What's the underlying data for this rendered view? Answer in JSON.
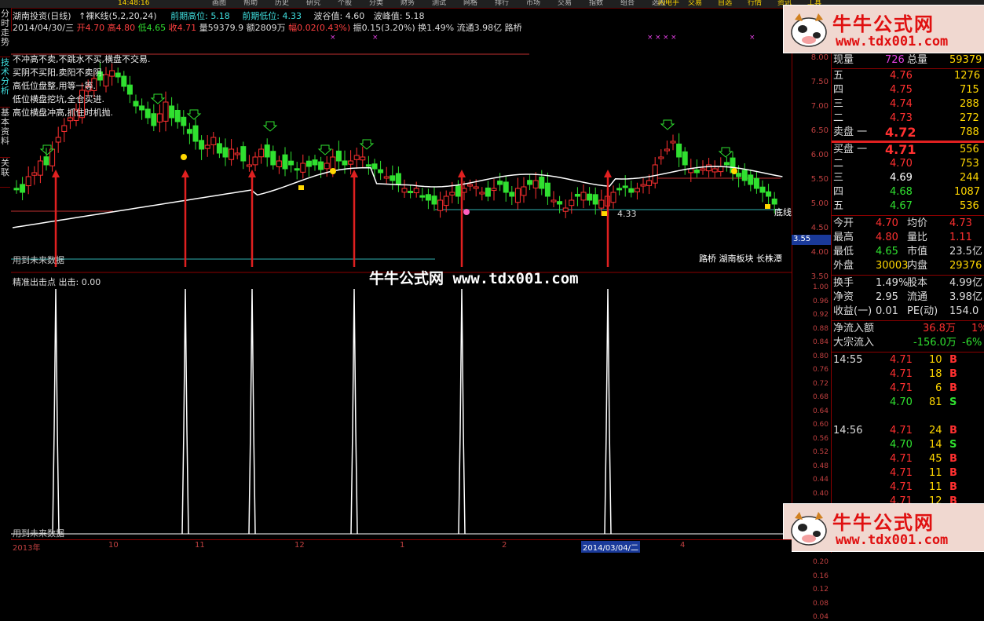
{
  "topbar": {
    "clock": "14:48:16",
    "menu": [
      "画图",
      "帮助",
      "历史",
      "研究",
      "个股",
      "分类",
      "财务",
      "测试",
      "网格",
      "排行",
      "市场",
      "交易",
      "指数",
      "组合",
      "选股"
    ],
    "right_buttons": [
      "闪电手",
      "交易",
      "自选",
      "行情",
      "资讯",
      "工具"
    ]
  },
  "sidetabs": [
    "分时走势",
    "技术分析",
    "基本资料",
    "关联"
  ],
  "header": {
    "stock_name": "湖南投资(日线)",
    "indicator_label": "↑裸K线(5,2,20,24)",
    "prev_high_label": "前期高位:",
    "prev_high_value": "5.18",
    "prev_low_label": "前期低位:",
    "prev_low_value": "4.33",
    "valley_label": "波谷值:",
    "valley_value": "4.60",
    "peak_label": "波峰值:",
    "peak_value": "5.18"
  },
  "ohlc": {
    "date": "2014/04/30/三",
    "open": "开4.70",
    "high": "高4.80",
    "low": "低4.65",
    "close": "收4.71",
    "volume": "量59379.9",
    "amount": "额2809万",
    "change": "幅0.02(0.43%)",
    "amplitude": "振0.15(3.20%)",
    "turnover": "换1.49%",
    "float": "流通3.98亿",
    "concept": "路桥"
  },
  "remarks": [
    "不冲高不卖,不跳水不买,横盘不交易.",
    "买阴不买阳,卖阳不卖阴.",
    "高低位盘整,用等一等.",
    "低位横盘挖坑,全仓买进.",
    "高位横盘冲高,抓住时机抛."
  ],
  "main_labels": {
    "future_note": "用到未来数据",
    "bottom_line": "底线",
    "low_marker": "4.33",
    "board_info": "路桥 湖南板块 长株潭"
  },
  "lower": {
    "label": "精准出击点 出击: 0.00",
    "future_note": "用到未来数据"
  },
  "watermark": "牛牛公式网 www.tdx001.com",
  "logo": {
    "title": "牛牛公式网",
    "url": "www.tdx001.com"
  },
  "price_scale": [
    "8.00",
    "7.50",
    "7.00",
    "6.50",
    "6.00",
    "5.50",
    "5.00",
    "4.50",
    "4.00",
    "3.50"
  ],
  "current_price_tag": "3.55",
  "lower_scale": [
    "1.00",
    "0.96",
    "0.92",
    "0.88",
    "0.84",
    "0.80",
    "0.76",
    "0.72",
    "0.68",
    "0.64",
    "0.60",
    "0.56",
    "0.52",
    "0.48",
    "0.44",
    "0.40",
    "0.36",
    "0.32",
    "0.28",
    "0.24",
    "0.20",
    "0.16",
    "0.12",
    "0.08",
    "0.04"
  ],
  "time_axis": [
    "2013年",
    "10",
    "11",
    "12",
    "1",
    "2",
    "2014/03/04/二",
    "4"
  ],
  "quote": {
    "now_label": "现量",
    "now_value": "726",
    "total_label": "总量",
    "total_value": "59379",
    "asks": [
      {
        "level": "五",
        "price": "4.76",
        "vol": "1276"
      },
      {
        "level": "四",
        "price": "4.75",
        "vol": "715"
      },
      {
        "level": "三",
        "price": "4.74",
        "vol": "288"
      },
      {
        "level": "二",
        "price": "4.73",
        "vol": "272"
      },
      {
        "level": "卖盘 一",
        "price": "4.72",
        "vol": "788"
      }
    ],
    "bids": [
      {
        "level": "买盘 一",
        "price": "4.71",
        "vol": "556"
      },
      {
        "level": "二",
        "price": "4.70",
        "vol": "753"
      },
      {
        "level": "三",
        "price": "4.69",
        "vol": "244"
      },
      {
        "level": "四",
        "price": "4.68",
        "vol": "1087"
      },
      {
        "level": "五",
        "price": "4.67",
        "vol": "536"
      }
    ],
    "stats": [
      {
        "l1": "今开",
        "v1": "4.70",
        "l2": "均价",
        "v2": "4.73"
      },
      {
        "l1": "最高",
        "v1": "4.80",
        "l2": "量比",
        "v2": "1.11"
      },
      {
        "l1": "最低",
        "v1": "4.65",
        "l2": "市值",
        "v2": "23.5亿"
      },
      {
        "l1": "外盘",
        "v1": "30003",
        "l2": "内盘",
        "v2": "29376"
      }
    ],
    "stats2": [
      {
        "l1": "换手",
        "v1": "1.49%",
        "l2": "股本",
        "v2": "4.99亿"
      },
      {
        "l1": "净资",
        "v1": "2.95",
        "l2": "流通",
        "v2": "3.98亿"
      },
      {
        "l1": "收益(一)",
        "v1": "0.01",
        "l2": "PE(动)",
        "v2": "154.0"
      }
    ],
    "flow": [
      {
        "label": "净流入额",
        "value": "36.8万",
        "pct": "1%"
      },
      {
        "label": "大宗流入",
        "value": "-156.0万",
        "pct": "-6%"
      }
    ],
    "ticks": [
      {
        "time": "14:55",
        "price": "4.71",
        "vol": "10",
        "side": "B"
      },
      {
        "time": "",
        "price": "4.71",
        "vol": "18",
        "side": "B"
      },
      {
        "time": "",
        "price": "4.71",
        "vol": "6",
        "side": "B"
      },
      {
        "time": "",
        "price": "4.70",
        "vol": "81",
        "side": "S"
      },
      {
        "time": "14:56",
        "price": "4.71",
        "vol": "24",
        "side": "B"
      },
      {
        "time": "",
        "price": "4.70",
        "vol": "14",
        "side": "S"
      },
      {
        "time": "",
        "price": "4.71",
        "vol": "45",
        "side": "B"
      },
      {
        "time": "",
        "price": "4.71",
        "vol": "11",
        "side": "B"
      },
      {
        "time": "",
        "price": "4.71",
        "vol": "11",
        "side": "B"
      },
      {
        "time": "",
        "price": "4.71",
        "vol": "12",
        "side": "B"
      }
    ]
  },
  "colors": {
    "up": "#ff3030",
    "down": "#30e030",
    "ma": "#ffffff",
    "frame": "#8b0000",
    "cyan": "#40c8c8"
  }
}
